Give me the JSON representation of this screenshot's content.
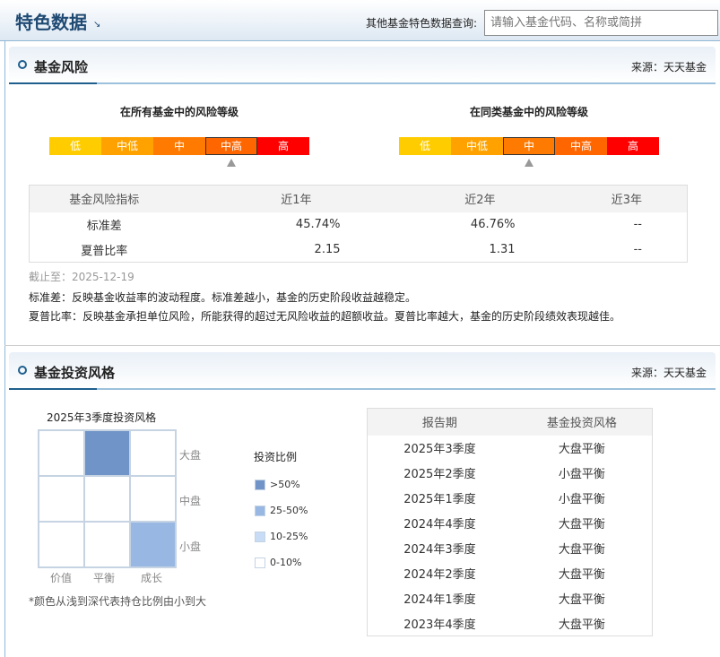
{
  "header": {
    "title": "特色数据",
    "arrow": "↘",
    "search_label": "其他基金特色数据查询:",
    "search_placeholder": "请输入基金代码、名称或简拼"
  },
  "risk": {
    "title": "基金风险",
    "source": "来源：天天基金",
    "gauges": [
      {
        "title": "在所有基金中的风险等级",
        "levels": [
          "低",
          "中低",
          "中",
          "中高",
          "高"
        ],
        "selected": 3
      },
      {
        "title": "在同类基金中的风险等级",
        "levels": [
          "低",
          "中低",
          "中",
          "中高",
          "高"
        ],
        "selected": 2
      }
    ],
    "level_colors": [
      "#ffcc00",
      "#ffa200",
      "#ff7a00",
      "#ff6600",
      "#ff0000"
    ],
    "table": {
      "headers": [
        "基金风险指标",
        "近1年",
        "近2年",
        "近3年"
      ],
      "rows": [
        [
          "标准差",
          "45.74%",
          "46.76%",
          "--"
        ],
        [
          "夏普比率",
          "2.15",
          "1.31",
          "--"
        ]
      ]
    },
    "as_of": "截止至：2025-12-19",
    "notes": [
      "标准差：反映基金收益率的波动程度。标准差越小，基金的历史阶段收益越稳定。",
      "夏普比率：反映基金承担单位风险，所能获得的超过无风险收益的超额收益。夏普比率越大，基金的历史阶段绩效表现越佳。"
    ]
  },
  "style": {
    "title": "基金投资风格",
    "source": "来源：天天基金",
    "box_title": "2025年3季度投资风格",
    "rows": [
      "大盘",
      "中盘",
      "小盘"
    ],
    "cols": [
      "价值",
      "平衡",
      "成长"
    ],
    "cells": [
      [
        0,
        3,
        0
      ],
      [
        0,
        0,
        0
      ],
      [
        0,
        0,
        2
      ]
    ],
    "legend_title": "投资比例",
    "legend": [
      {
        "label": ">50%",
        "color": "#7094c8"
      },
      {
        "label": "25-50%",
        "color": "#98b8e3"
      },
      {
        "label": "10-25%",
        "color": "#c8dcf5"
      },
      {
        "label": "0-10%",
        "color": "#ffffff"
      }
    ],
    "footnote": "*颜色从浅到深代表持仓比例由小到大",
    "table": {
      "headers": [
        "报告期",
        "基金投资风格"
      ],
      "rows": [
        [
          "2025年3季度",
          "大盘平衡"
        ],
        [
          "2025年2季度",
          "小盘平衡"
        ],
        [
          "2025年1季度",
          "小盘平衡"
        ],
        [
          "2024年4季度",
          "大盘平衡"
        ],
        [
          "2024年3季度",
          "大盘平衡"
        ],
        [
          "2024年2季度",
          "大盘平衡"
        ],
        [
          "2024年1季度",
          "大盘平衡"
        ],
        [
          "2023年4季度",
          "大盘平衡"
        ]
      ]
    }
  }
}
